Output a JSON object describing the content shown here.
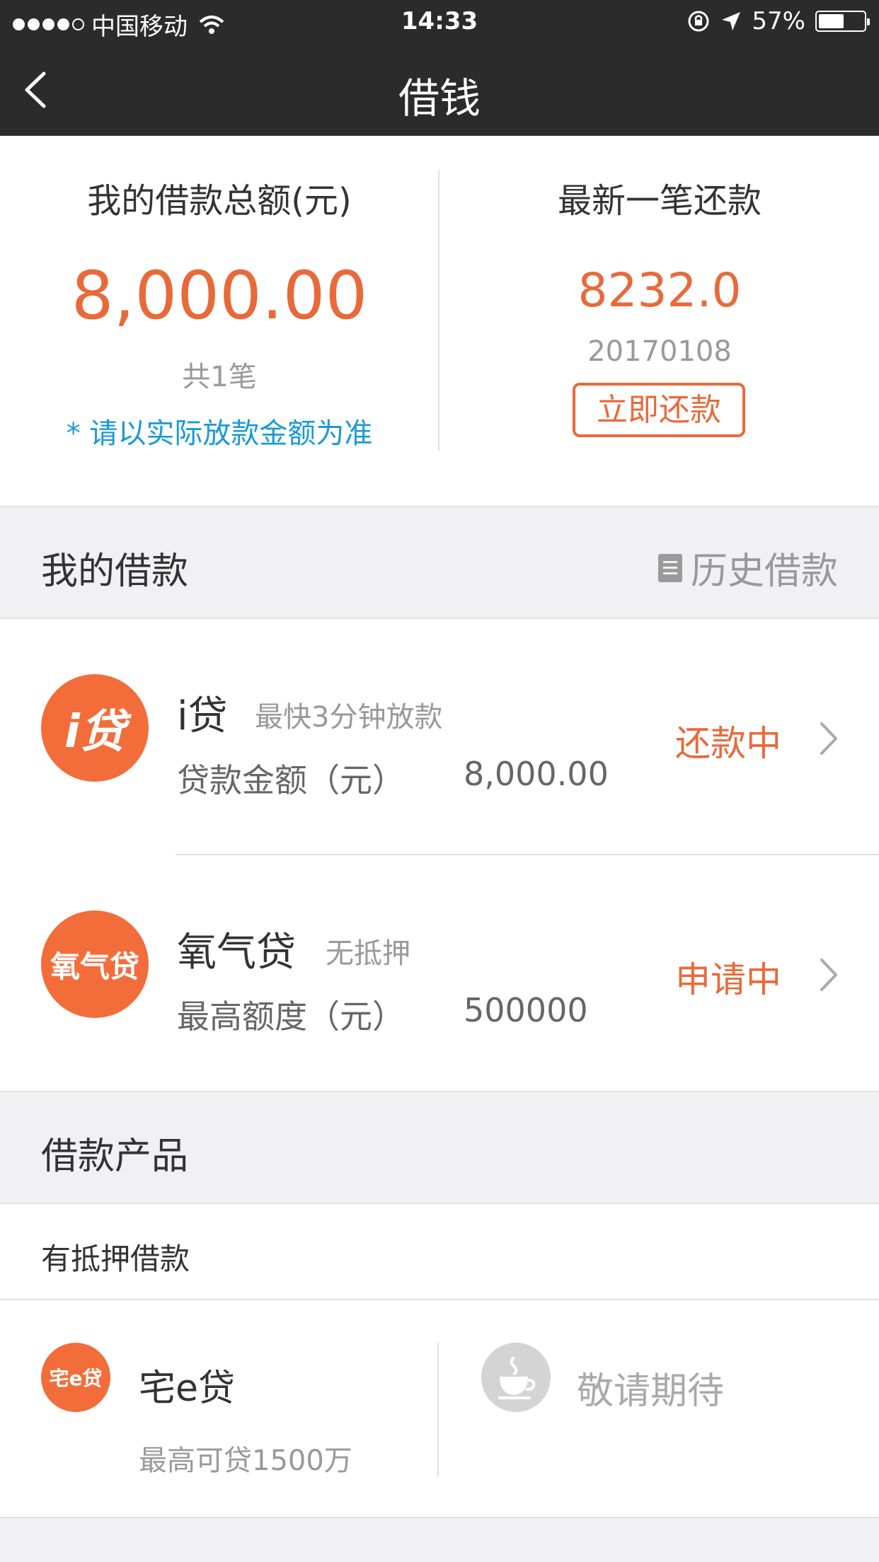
{
  "status_bar": {
    "carrier": "中国移动",
    "time": "14:33",
    "battery_text": "57%",
    "battery_level": 0.57,
    "signal_bars_filled": 4,
    "signal_bars_total": 5
  },
  "nav": {
    "title": "借钱",
    "back_icon": "chevron-left-icon"
  },
  "summary": {
    "total": {
      "title": "我的借款总额(元)",
      "amount": "8,000.00",
      "count": "共1笔",
      "note": "* 请以实际放款金额为准"
    },
    "latest": {
      "title": "最新一笔还款",
      "amount": "8232.0",
      "date": "20170108",
      "button": "立即还款"
    }
  },
  "my_loans": {
    "header": "我的借款",
    "history_label": "历史借款",
    "history_icon": "document-icon",
    "items": [
      {
        "logo_text": "i贷",
        "name": "i贷",
        "tagline": "最快3分钟放款",
        "field_label": "贷款金额（元）",
        "field_value": "8,000.00",
        "status": "还款中"
      },
      {
        "logo_text": "氧气贷",
        "name": "氧气贷",
        "tagline": "无抵押",
        "field_label": "最高额度（元）",
        "field_value": "500000",
        "status": "申请中"
      }
    ]
  },
  "products": {
    "header": "借款产品",
    "subheader": "有抵押借款",
    "items": [
      {
        "logo_text": "宅e贷",
        "name": "宅e贷",
        "max": "最高可贷1500万"
      },
      {
        "icon": "coffee-cup-icon",
        "name": "敬请期待"
      }
    ]
  },
  "colors": {
    "accent": "#e86a3a",
    "logo_bg": "#f26d3a",
    "link": "#1a9ad6",
    "header_bg": "#2b2b2b"
  }
}
